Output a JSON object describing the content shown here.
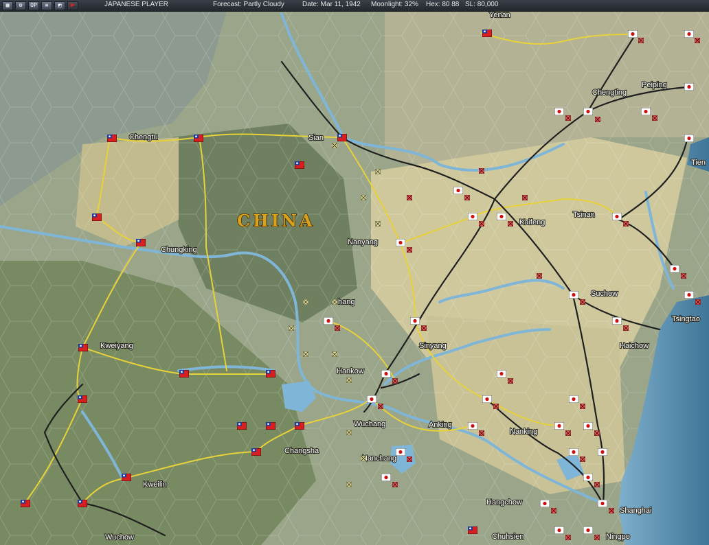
{
  "topbar": {
    "icons": [
      "map-icon",
      "options-icon",
      "op-icon",
      "list-icon",
      "window-icon",
      "play-icon"
    ],
    "op_label": "OP",
    "player": "JAPANESE PLAYER",
    "forecast": "Forecast: Partly Cloudy",
    "date": "Date: Mar 11, 1942",
    "moonlight": "Moonlight: 32%",
    "hex": "Hex: 80  88",
    "sl": "SL: 80,000"
  },
  "map": {
    "country_label": "CHINA",
    "cities": {
      "yenan": "Yenan",
      "peiping": "Peiping",
      "chengting": "Chengting",
      "chengtu": "Chengtu",
      "sian": "Sian",
      "tien": "Tien",
      "tsinan": "Tsinan",
      "kaifeng": "Kaifeng",
      "nanyang": "Nanyang",
      "chungking": "Chungking",
      "suchow": "Suchow",
      "tsingtao": "Tsingtao",
      "hsiang": "hang",
      "sinyang": "Sinyang",
      "haichow": "Haichow",
      "kweiyang": "Kweiyang",
      "hankow": "Hankow",
      "wuchang": "Wuchang",
      "anking": "Anking",
      "nanking": "Nanking",
      "changsha": "Changsha",
      "nanchang": "Nanchang",
      "kweilin": "Kweilin",
      "hangchow": "Hangchow",
      "shanghai": "Shanghai",
      "chuhsien": "Chuhsien",
      "ningpo": "Ningpo",
      "wuchow": "Wuchow"
    }
  },
  "colors": {
    "chinese_flag_red": "#d81e1e",
    "chinese_flag_blue": "#1e3a9a",
    "japanese_flag_white": "#ffffff",
    "japanese_flag_red": "#cc1010",
    "road": "#e7d23a",
    "river": "#7fb6d8",
    "rail": "#1f1f1f",
    "sea": "#5a8fb0"
  }
}
